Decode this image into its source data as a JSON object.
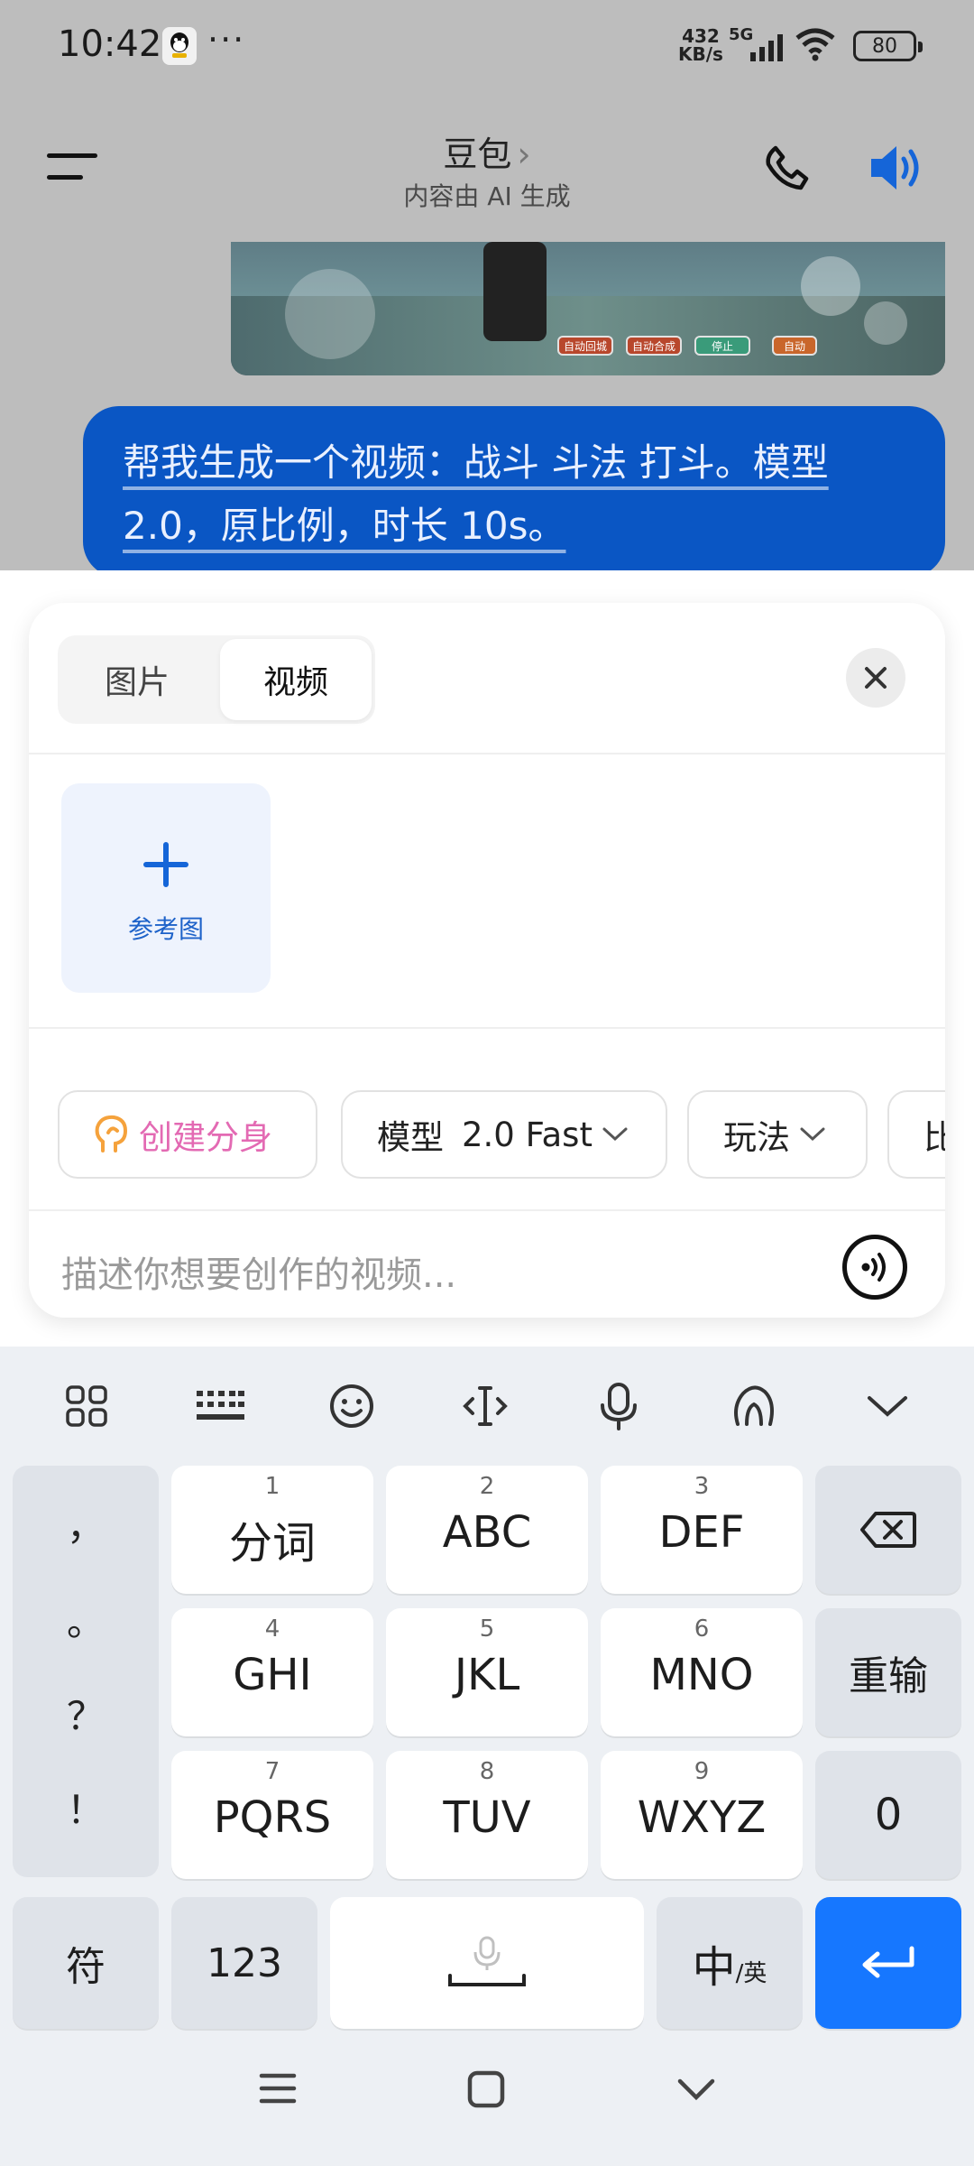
{
  "status_bar": {
    "time": "10:42",
    "more": "···",
    "net_speed_value": "432",
    "net_speed_unit": "KB/s",
    "network": "5G",
    "battery": "80"
  },
  "header": {
    "title": "豆包",
    "title_chevron": "›",
    "subtitle": "内容由 AI 生成"
  },
  "game_thumb": {
    "chips": [
      "自动回城",
      "自动合成",
      "停止",
      "自动"
    ]
  },
  "chat": {
    "user_message": "帮我生成一个视频：战斗 斗法  打斗。模型 2.0，原比例，时长 10s。"
  },
  "panel": {
    "tabs": [
      {
        "label": "图片",
        "active": false
      },
      {
        "label": "视频",
        "active": true
      }
    ],
    "reference_label": "参考图",
    "chips": {
      "avatar": "创建分身",
      "model_prefix": "模型",
      "model_value": "2.0 Fast",
      "play": "玩法",
      "ratio": "比"
    },
    "prompt_placeholder": "描述你想要创作的视频..."
  },
  "keyboard": {
    "punct": [
      "，",
      "。",
      "？",
      "！"
    ],
    "keys": [
      {
        "num": "1",
        "label": "分词"
      },
      {
        "num": "2",
        "label": "ABC"
      },
      {
        "num": "3",
        "label": "DEF"
      },
      {
        "num": "4",
        "label": "GHI"
      },
      {
        "num": "5",
        "label": "JKL"
      },
      {
        "num": "6",
        "label": "MNO"
      },
      {
        "num": "7",
        "label": "PQRS"
      },
      {
        "num": "8",
        "label": "TUV"
      },
      {
        "num": "9",
        "label": "WXYZ"
      }
    ],
    "reinput": "重输",
    "zero": "0",
    "symbols": "符",
    "num123": "123",
    "lang_main": "中",
    "lang_alt": "/英"
  },
  "colors": {
    "accent_blue": "#1677ff",
    "bubble_blue": "#0a56c4",
    "avatar_pink": "#e36ab3",
    "avatar_orange": "#f5a23c"
  }
}
